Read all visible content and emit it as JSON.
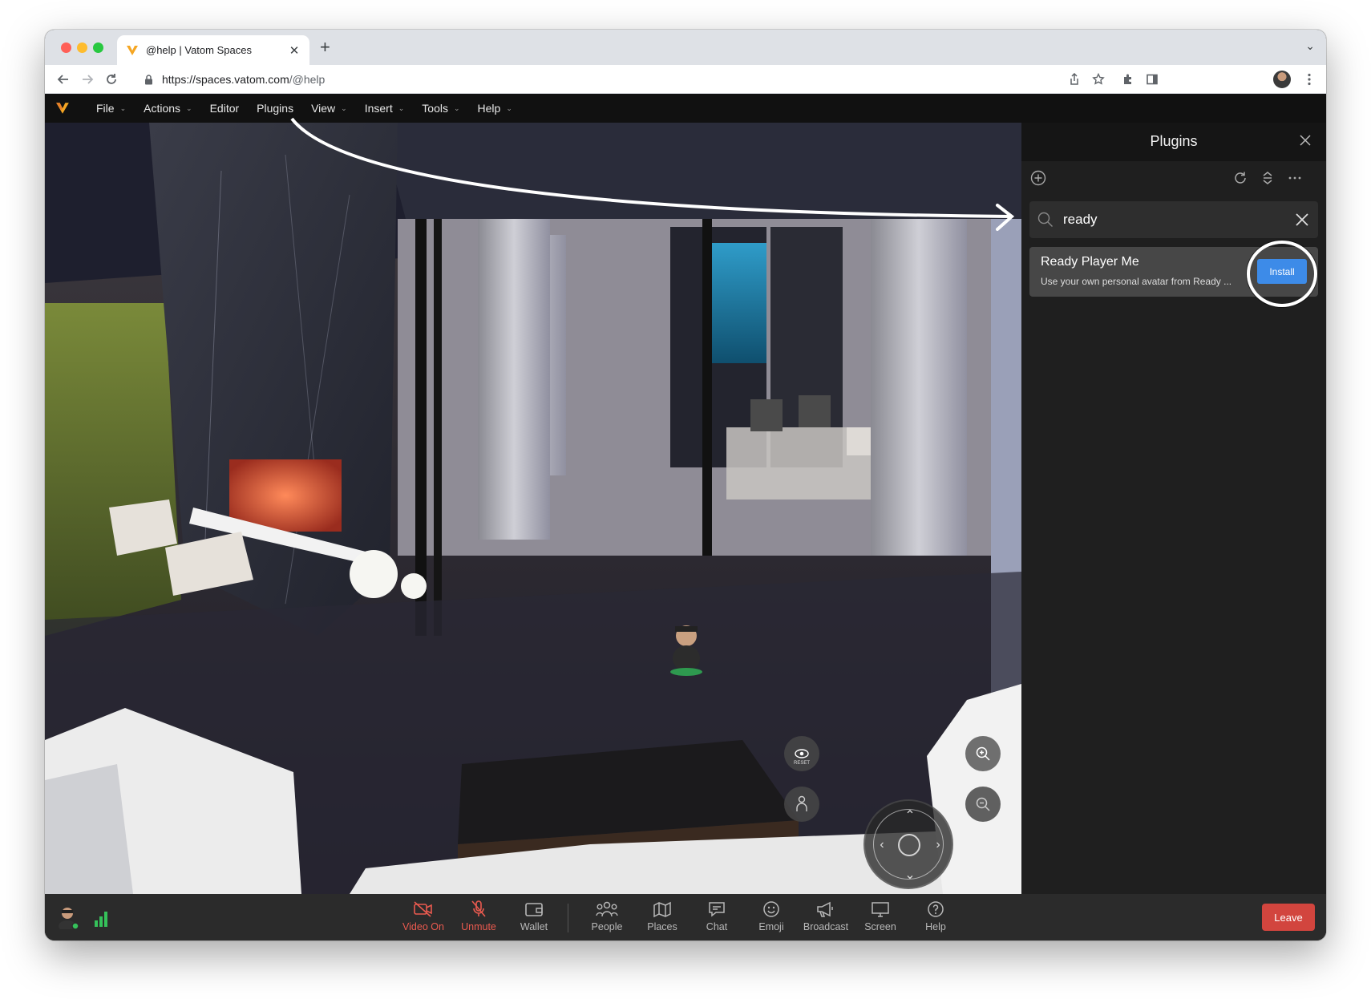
{
  "browser": {
    "tab_title": "@help | Vatom Spaces",
    "url_host": "https://spaces.vatom.com",
    "url_path": "/@help"
  },
  "menubar": {
    "items": [
      {
        "label": "File",
        "has_caret": true
      },
      {
        "label": "Actions",
        "has_caret": true
      },
      {
        "label": "Editor",
        "has_caret": false
      },
      {
        "label": "Plugins",
        "has_caret": false
      },
      {
        "label": "View",
        "has_caret": true
      },
      {
        "label": "Insert",
        "has_caret": true
      },
      {
        "label": "Tools",
        "has_caret": true
      },
      {
        "label": "Help",
        "has_caret": true
      }
    ]
  },
  "plugins_panel": {
    "title": "Plugins",
    "search_value": "ready",
    "results": [
      {
        "name": "Ready Player Me",
        "description": "Use your own personal avatar from Ready ...",
        "action_label": "Install"
      }
    ]
  },
  "viewport_controls": {
    "reset_label": "RESET"
  },
  "bottombar": {
    "items": [
      {
        "id": "video",
        "label": "Video On",
        "icon": "video-off-icon",
        "alert": true
      },
      {
        "id": "mute",
        "label": "Unmute",
        "icon": "mic-off-icon",
        "alert": true
      },
      {
        "id": "wallet",
        "label": "Wallet",
        "icon": "wallet-icon",
        "alert": false
      },
      {
        "id": "people",
        "label": "People",
        "icon": "people-icon",
        "alert": false
      },
      {
        "id": "places",
        "label": "Places",
        "icon": "map-icon",
        "alert": false
      },
      {
        "id": "chat",
        "label": "Chat",
        "icon": "chat-icon",
        "alert": false
      },
      {
        "id": "emoji",
        "label": "Emoji",
        "icon": "smiley-icon",
        "alert": false
      },
      {
        "id": "broadcast",
        "label": "Broadcast",
        "icon": "megaphone-icon",
        "alert": false
      },
      {
        "id": "screen",
        "label": "Screen",
        "icon": "monitor-icon",
        "alert": false
      },
      {
        "id": "help",
        "label": "Help",
        "icon": "question-icon",
        "alert": false
      }
    ],
    "leave_label": "Leave"
  },
  "colors": {
    "accent_blue": "#3d8be8",
    "alert_red": "#ea5a4f",
    "leave_red": "#d2453e",
    "brand_orange": "#f5a623"
  }
}
